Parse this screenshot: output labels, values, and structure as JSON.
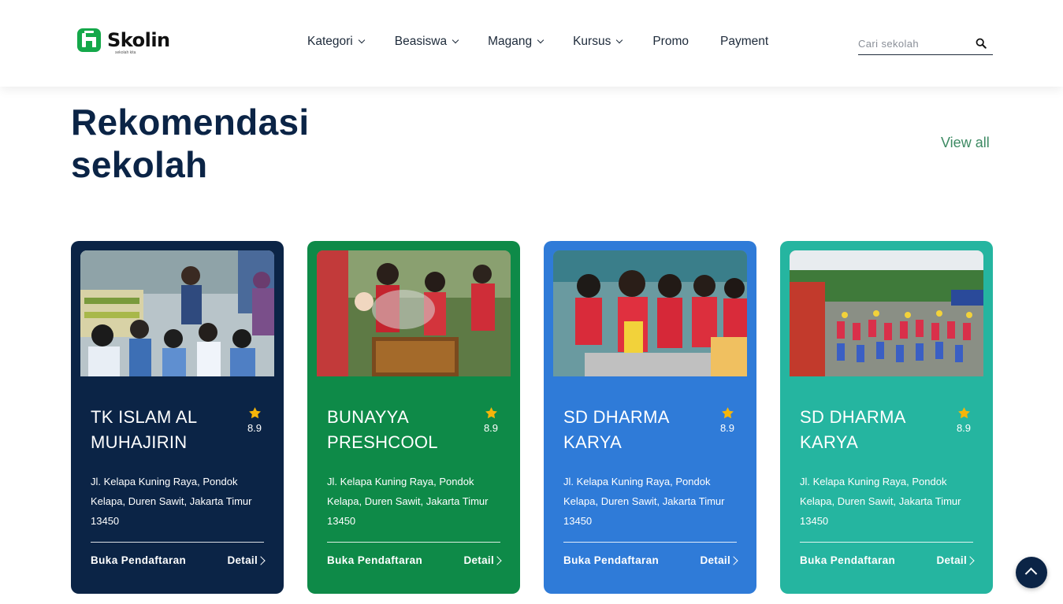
{
  "header": {
    "logo_text": "Skolin",
    "logo_tagline": "sekolah kita",
    "nav": [
      {
        "label": "Kategori",
        "dropdown": true
      },
      {
        "label": "Beasiswa",
        "dropdown": true
      },
      {
        "label": "Magang",
        "dropdown": true
      },
      {
        "label": "Kursus",
        "dropdown": true
      },
      {
        "label": "Promo",
        "dropdown": false
      },
      {
        "label": "Payment",
        "dropdown": false
      }
    ],
    "search": {
      "placeholder": "Cari sekolah",
      "value": "",
      "icon": "search-icon"
    }
  },
  "section": {
    "title": "Rekomendasi sekolah",
    "view_all": "View all"
  },
  "cards": [
    {
      "name": "TK ISLAM AL MUHAJIRIN",
      "rating": "8.9",
      "address": "Jl. Kelapa Kuning Raya, Pondok Kelapa, Duren Sawit, Jakarta Timur 13450",
      "open_label": "Buka Pendaftaran",
      "detail_label": "Detail",
      "color": "#0b2446"
    },
    {
      "name": "BUNAYYA PRESHCOOL",
      "rating": "8.9",
      "address": "Jl. Kelapa Kuning Raya, Pondok Kelapa, Duren Sawit, Jakarta Timur 13450",
      "open_label": "Buka Pendaftaran",
      "detail_label": "Detail",
      "color": "#0e8a48"
    },
    {
      "name": "SD DHARMA KARYA",
      "rating": "8.9",
      "address": "Jl. Kelapa Kuning Raya, Pondok Kelapa, Duren Sawit, Jakarta Timur 13450",
      "open_label": "Buka Pendaftaran",
      "detail_label": "Detail",
      "color": "#2f7bd8"
    },
    {
      "name": "SD DHARMA KARYA",
      "rating": "8.9",
      "address": "Jl. Kelapa Kuning Raya, Pondok Kelapa, Duren Sawit, Jakarta Timur 13450",
      "open_label": "Buka Pendaftaran",
      "detail_label": "Detail",
      "color": "#25b5a0"
    }
  ],
  "colors": {
    "primary": "#0b2446",
    "brand_green": "#14a84a",
    "link_green": "#3d8a63",
    "star": "#f5b50a"
  },
  "scroll_top_icon": "chevron-up-icon"
}
